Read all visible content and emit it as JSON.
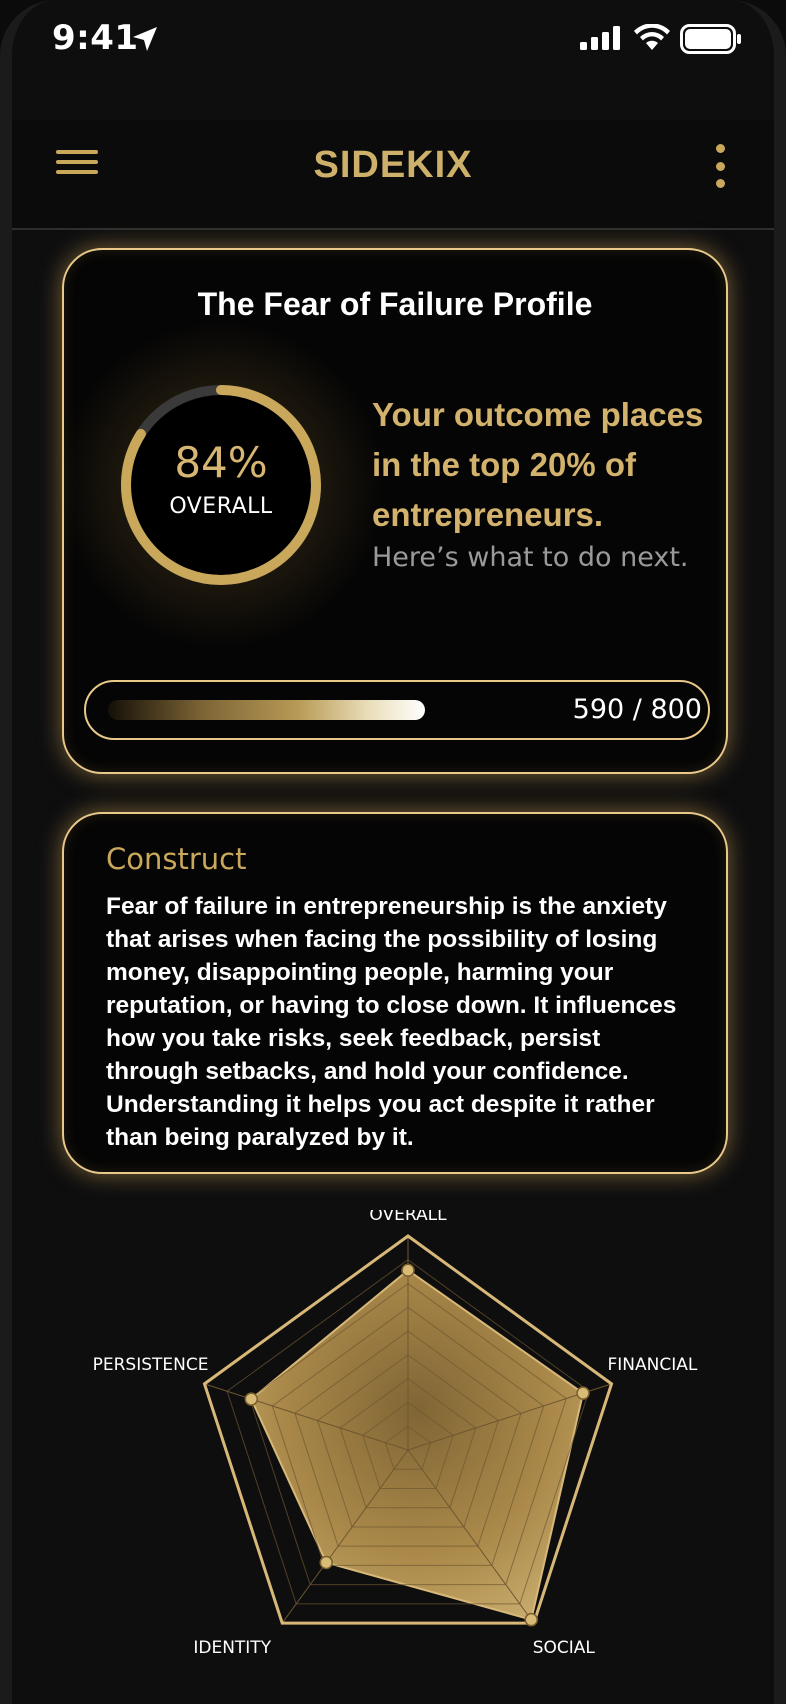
{
  "status_bar": {
    "time": "9:41"
  },
  "nav": {
    "logo": "SIDEKIX"
  },
  "profile": {
    "title": "The Fear of Failure Profile",
    "percent": "84%",
    "percent_value": 0.84,
    "overall_label": "OVERALL",
    "outcome": "Your outcome places in the top 20% of entrepreneurs.",
    "next_step": "Here’s what to do next.",
    "score_text": "590 / 800",
    "score_value": 590,
    "score_max": 800
  },
  "construct": {
    "title": "Construct",
    "body": "Fear of failure in entrepreneurship is the anxiety that arises when facing the possibility of losing money, disappointing people, harming your reputation, or having to close down. It influences how you take risks, seek feedback, persist through setbacks, and hold your confidence. Understanding it helps you act despite it rather than being paralyzed by it."
  },
  "radar": {
    "axes": [
      "OVERALL",
      "FINANCIAL",
      "SOCIAL",
      "IDENTITY",
      "PERSISTENCE"
    ],
    "values": [
      0.84,
      0.86,
      0.98,
      0.65,
      0.77
    ],
    "colors": {
      "accent": "#c9a85c",
      "fill": "#b8944f",
      "outline": "#d8b878"
    }
  }
}
